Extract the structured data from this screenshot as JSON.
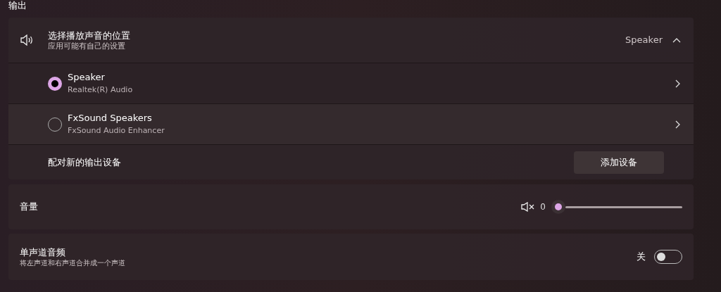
{
  "section_title": "输出",
  "output": {
    "title": "选择播放声音的位置",
    "subtitle": "应用可能有自己的设置",
    "current": "Speaker",
    "expanded": true,
    "devices": [
      {
        "name": "Speaker",
        "detail": "Realtek(R) Audio",
        "selected": true
      },
      {
        "name": "FxSound Speakers",
        "detail": "FxSound Audio Enhancer",
        "selected": false
      }
    ],
    "pair": {
      "label": "配对新的输出设备",
      "button": "添加设备"
    }
  },
  "volume": {
    "label": "音量",
    "muted": true,
    "reading": "0"
  },
  "mono": {
    "title": "单声道音频",
    "subtitle": "将左声道和右声道合并成一个声道",
    "state_label": "关",
    "on": false
  }
}
